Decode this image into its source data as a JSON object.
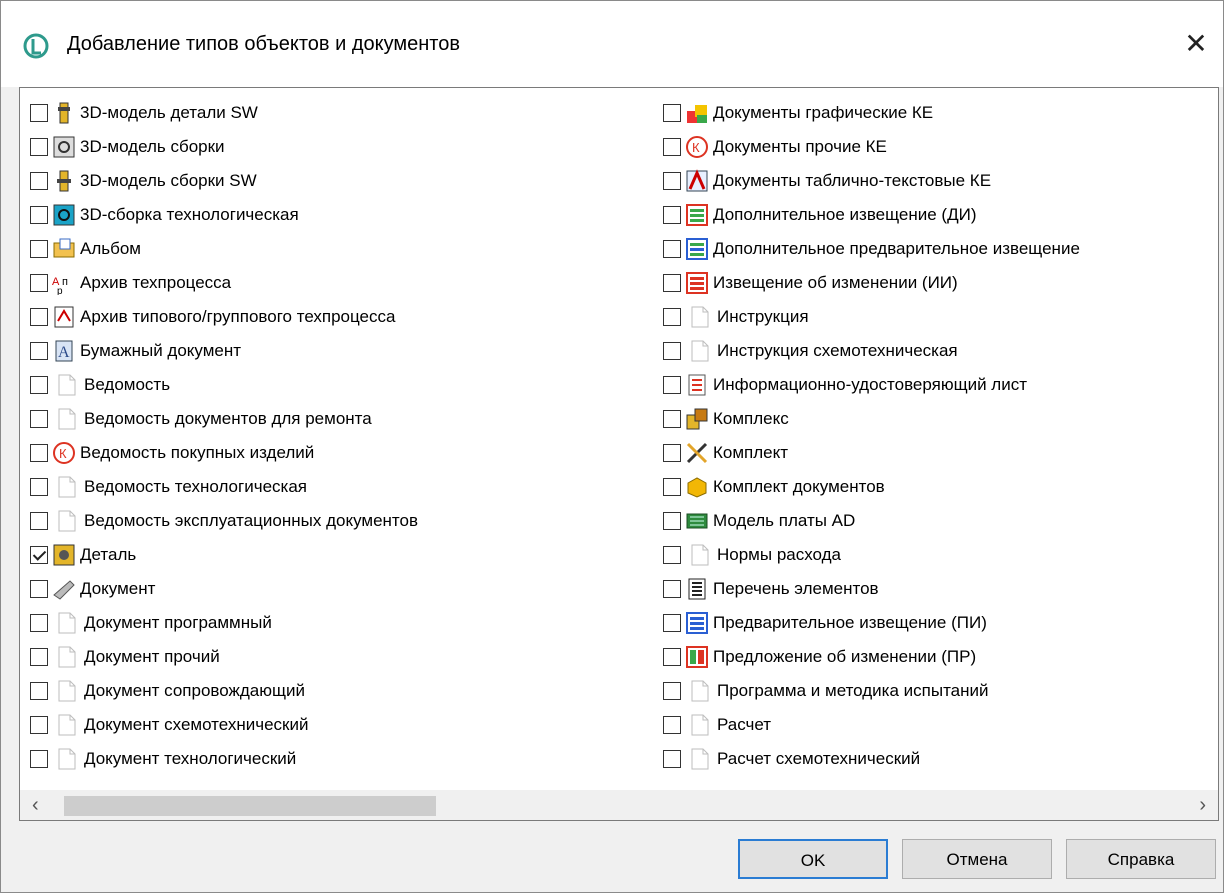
{
  "window": {
    "title": "Добавление типов объектов и документов",
    "close_glyph": "✕"
  },
  "left_items": [
    {
      "label": "3D-модель детали SW",
      "checked": false,
      "icon": "gear-part-sw-icon"
    },
    {
      "label": "3D-модель сборки",
      "checked": false,
      "icon": "assembly-icon"
    },
    {
      "label": "3D-модель сборки SW",
      "checked": false,
      "icon": "assembly-sw-icon"
    },
    {
      "label": "3D-сборка технологическая",
      "checked": false,
      "icon": "tech-assembly-icon"
    },
    {
      "label": "Альбом",
      "checked": false,
      "icon": "album-icon"
    },
    {
      "label": "Архив техпроцесса",
      "checked": false,
      "icon": "process-archive-icon"
    },
    {
      "label": "Архив типового/группового техпроцесса",
      "checked": false,
      "icon": "group-process-archive-icon"
    },
    {
      "label": "Бумажный документ",
      "checked": false,
      "icon": "paper-document-icon"
    },
    {
      "label": "Ведомость",
      "checked": false,
      "icon": "document-icon"
    },
    {
      "label": "Ведомость документов для ремонта",
      "checked": false,
      "icon": "document-icon"
    },
    {
      "label": "Ведомость покупных изделий",
      "checked": false,
      "icon": "purchased-icon"
    },
    {
      "label": "Ведомость технологическая",
      "checked": false,
      "icon": "document-icon"
    },
    {
      "label": "Ведомость эксплуатационных документов",
      "checked": false,
      "icon": "document-icon"
    },
    {
      "label": "Деталь",
      "checked": true,
      "icon": "part-icon"
    },
    {
      "label": "Документ",
      "checked": false,
      "icon": "generic-document-icon"
    },
    {
      "label": "Документ программный",
      "checked": false,
      "icon": "document-icon"
    },
    {
      "label": "Документ прочий",
      "checked": false,
      "icon": "document-icon"
    },
    {
      "label": "Документ сопровождающий",
      "checked": false,
      "icon": "document-icon"
    },
    {
      "label": "Документ схемотехнический",
      "checked": false,
      "icon": "document-icon"
    },
    {
      "label": "Документ технологический",
      "checked": false,
      "icon": "document-icon"
    }
  ],
  "right_items": [
    {
      "label": "Документы графические КЕ",
      "checked": false,
      "icon": "graphic-docs-icon"
    },
    {
      "label": "Документы прочие КЕ",
      "checked": false,
      "icon": "other-docs-icon"
    },
    {
      "label": "Документы таблично-текстовые КЕ",
      "checked": false,
      "icon": "table-text-docs-icon"
    },
    {
      "label": "Дополнительное извещение (ДИ)",
      "checked": false,
      "icon": "notice-green-icon"
    },
    {
      "label": "Дополнительное предварительное извещение",
      "checked": false,
      "icon": "notice-blue-green-icon"
    },
    {
      "label": "Извещение об изменении (ИИ)",
      "checked": false,
      "icon": "notice-red-icon"
    },
    {
      "label": "Инструкция",
      "checked": false,
      "icon": "document-icon"
    },
    {
      "label": "Инструкция схемотехническая",
      "checked": false,
      "icon": "document-icon"
    },
    {
      "label": "Информационно-удостоверяющий лист",
      "checked": false,
      "icon": "info-sheet-icon"
    },
    {
      "label": "Комплекс",
      "checked": false,
      "icon": "complex-icon"
    },
    {
      "label": "Комплект",
      "checked": false,
      "icon": "kit-tools-icon"
    },
    {
      "label": "Комплект документов",
      "checked": false,
      "icon": "box-icon"
    },
    {
      "label": "Модель платы AD",
      "checked": false,
      "icon": "circuit-board-icon"
    },
    {
      "label": "Нормы расхода",
      "checked": false,
      "icon": "document-icon"
    },
    {
      "label": "Перечень элементов",
      "checked": false,
      "icon": "list-icon"
    },
    {
      "label": "Предварительное извещение (ПИ)",
      "checked": false,
      "icon": "notice-blue-icon"
    },
    {
      "label": "Предложение об изменении (ПР)",
      "checked": false,
      "icon": "proposal-icon"
    },
    {
      "label": "Программа и методика испытаний",
      "checked": false,
      "icon": "document-icon"
    },
    {
      "label": "Расчет",
      "checked": false,
      "icon": "document-icon"
    },
    {
      "label": "Расчет схемотехнический",
      "checked": false,
      "icon": "document-icon"
    }
  ],
  "scrollbar": {
    "left_arrow": "‹",
    "right_arrow": "›"
  },
  "buttons": {
    "ok": "OK",
    "cancel": "Отмена",
    "help": "Справка"
  }
}
